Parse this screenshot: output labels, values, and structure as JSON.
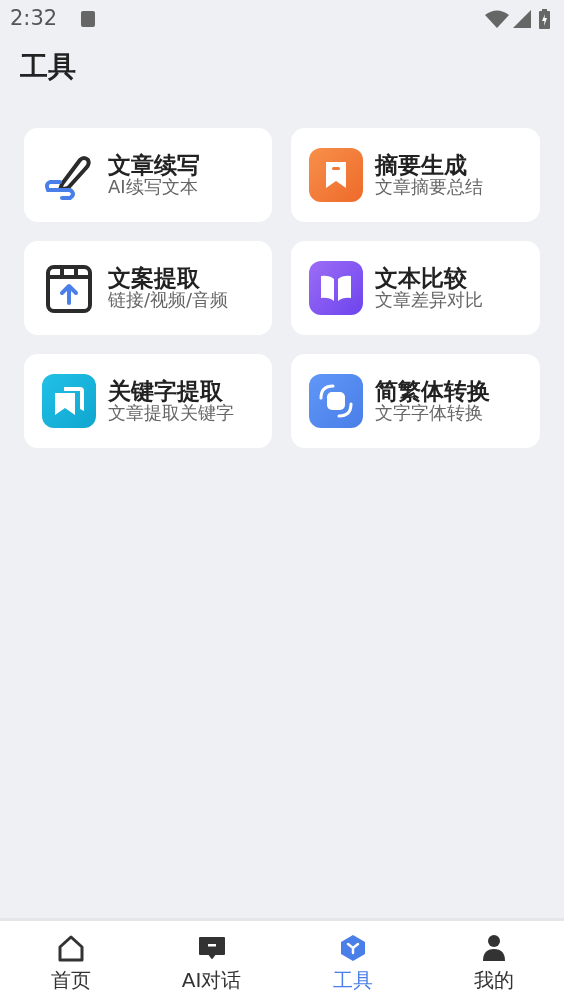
{
  "status_bar": {
    "time": "2:32"
  },
  "title": "工具",
  "tools": [
    {
      "kind": "pen",
      "title": "文章续写",
      "subtitle": "AI续写文本"
    },
    {
      "kind": "summary",
      "title": "摘要生成",
      "subtitle": "文章摘要总结"
    },
    {
      "kind": "extract",
      "title": "文案提取",
      "subtitle": "链接/视频/音频"
    },
    {
      "kind": "compare",
      "title": "文本比较",
      "subtitle": "文章差异对比"
    },
    {
      "kind": "keyword",
      "title": "关键字提取",
      "subtitle": "文章提取关键字"
    },
    {
      "kind": "convert",
      "title": "简繁体转换",
      "subtitle": "文字字体转换"
    }
  ],
  "tabs": [
    {
      "kind": "home",
      "label": "首页",
      "selected": false
    },
    {
      "kind": "chat",
      "label": "AI对话",
      "selected": false
    },
    {
      "kind": "tools",
      "label": "工具",
      "selected": true
    },
    {
      "kind": "me",
      "label": "我的",
      "selected": false
    }
  ]
}
